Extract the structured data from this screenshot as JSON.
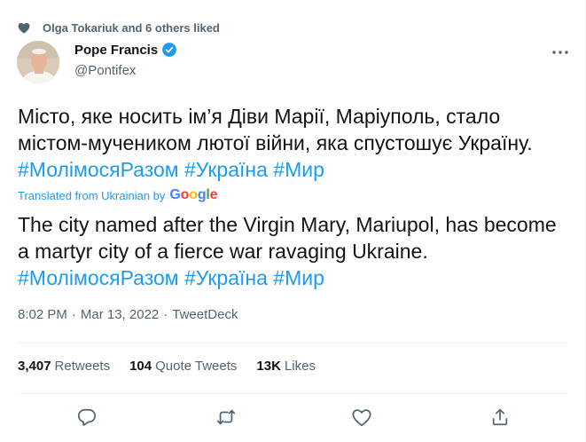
{
  "social_context": {
    "text": "Olga Tokariuk and 6 others liked",
    "icon": "heart-icon"
  },
  "author": {
    "name": "Pope Francis",
    "handle": "@Pontifex",
    "verified": true,
    "avatar": "avatar"
  },
  "tweet": {
    "original": {
      "text": "Місто, яке носить ім’я Діви Марії, Маріуполь, стало містом-мучеником лютої війни, яка спустошує Україну.",
      "hashtags": [
        "#МолімосяРазом",
        "#Україна",
        "#Мир"
      ]
    },
    "translation_note": {
      "label": "Translated from Ukrainian by",
      "provider": "Google"
    },
    "translated": {
      "text": "The city named after the Virgin Mary, Mariupol, has become a martyr city of a fierce war ravaging Ukraine.",
      "hashtags": [
        "#МолімосяРазом",
        "#Україна",
        "#Мир"
      ]
    }
  },
  "meta": {
    "time": "8:02 PM",
    "date": "Mar 13, 2022",
    "source": "TweetDeck",
    "separator": "·"
  },
  "stats": {
    "retweets": {
      "count": "3,407",
      "label": "Retweets"
    },
    "quotes": {
      "count": "104",
      "label": "Quote Tweets"
    },
    "likes": {
      "count": "13K",
      "label": "Likes"
    }
  },
  "actions": [
    "reply-icon",
    "retweet-icon",
    "like-icon",
    "share-icon"
  ],
  "colors": {
    "accent": "#1d9bf0",
    "text": "#0f1419",
    "secondary": "#536471",
    "border": "#eff3f4"
  }
}
